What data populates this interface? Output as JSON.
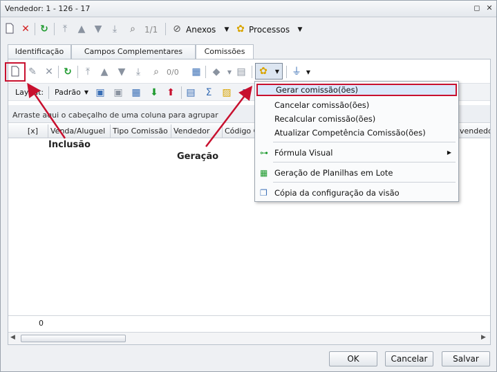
{
  "window": {
    "title": "Vendedor: 1 - 126 - 17"
  },
  "toolbar": {
    "record_position": "1/1",
    "anexos_label": "Anexos",
    "processos_label": "Processos"
  },
  "tabs": [
    {
      "label": "Identificação"
    },
    {
      "label": "Campos Complementares"
    },
    {
      "label": "Comissões"
    }
  ],
  "grid_toolbar": {
    "record_position": "0/0"
  },
  "layout_bar": {
    "layout_label": "Layout:",
    "layout_value": "Padrão"
  },
  "grid": {
    "group_hint": "Arraste aqui o cabeçalho de uma coluna para agrupar",
    "columns": [
      "[x]",
      "Venda/Aluguel",
      "Tipo Comissão",
      "Vendedor",
      "Código Co",
      "vendedo"
    ],
    "footer_count": "0"
  },
  "context_menu": {
    "items": [
      {
        "label": "Gerar comissão(ões)"
      },
      {
        "label": "Cancelar comissão(ões)"
      },
      {
        "label": "Recalcular comissão(ões)"
      },
      {
        "label": "Atualizar Competência Comissão(ões)"
      },
      {
        "label": "Fórmula Visual"
      },
      {
        "label": "Geração de Planilhas em Lote"
      },
      {
        "label": "Cópia da configuração da visão"
      }
    ]
  },
  "annotations": {
    "inclusao": "Inclusão",
    "geracao": "Geração"
  },
  "buttons": {
    "ok": "OK",
    "cancelar": "Cancelar",
    "salvar": "Salvar"
  },
  "colors": {
    "highlight_red": "#c8102e",
    "menu_highlight": "#dbe8fb"
  }
}
